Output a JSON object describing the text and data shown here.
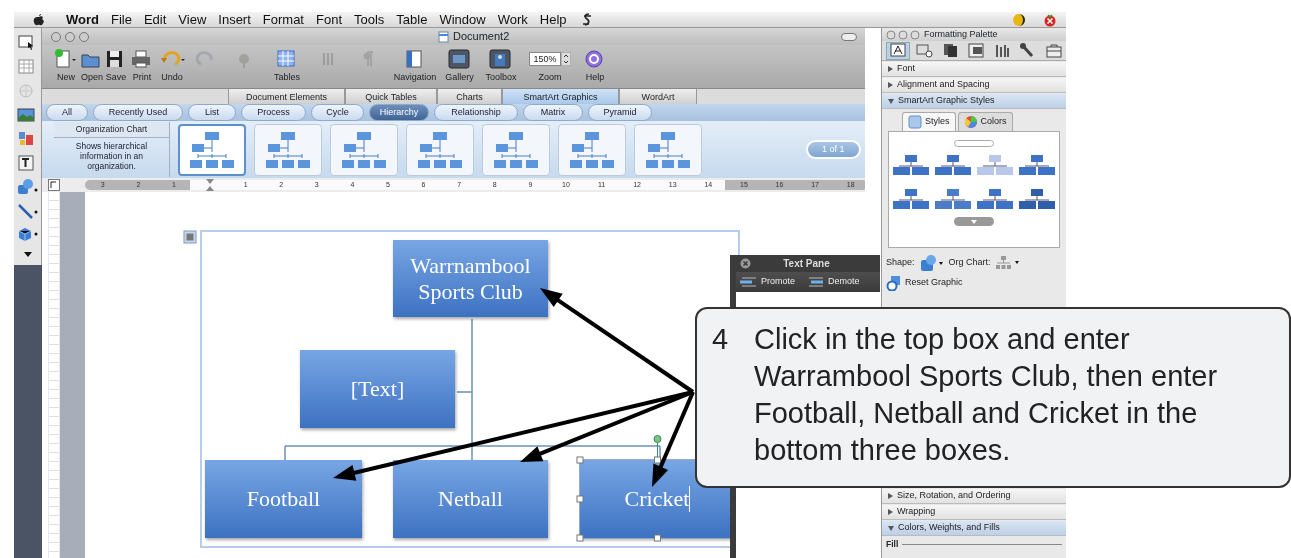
{
  "menu_bar": {
    "app": "Word",
    "items": [
      "File",
      "Edit",
      "View",
      "Insert",
      "Format",
      "Font",
      "Tools",
      "Table",
      "Window",
      "Work",
      "Help"
    ]
  },
  "window": {
    "title": "Document2"
  },
  "toolbar": [
    {
      "kind": "button",
      "label": "New",
      "disabled": false,
      "pressed": false
    },
    {
      "kind": "button",
      "label": "Open",
      "disabled": false,
      "pressed": false
    },
    {
      "kind": "button",
      "label": "Save",
      "disabled": false,
      "pressed": false
    },
    {
      "kind": "button",
      "label": "Print",
      "disabled": false,
      "pressed": false
    },
    {
      "kind": "button",
      "label": "Undo",
      "disabled": false,
      "pressed": false
    },
    {
      "kind": "button",
      "disabled": true,
      "pressed": false
    },
    {
      "kind": "button",
      "disabled": true,
      "pressed": false
    },
    {
      "kind": "button",
      "label": "Tables",
      "disabled": false,
      "pressed": false
    },
    {
      "kind": "button",
      "disabled": true,
      "pressed": false
    },
    {
      "kind": "button",
      "disabled": true,
      "pressed": false
    },
    {
      "kind": "button",
      "label": "Navigation",
      "disabled": false,
      "pressed": false
    },
    {
      "kind": "button",
      "label": "Gallery",
      "disabled": false,
      "pressed": true
    },
    {
      "kind": "button",
      "label": "Toolbox",
      "disabled": false,
      "pressed": true
    },
    {
      "kind": "zoom",
      "label": "Zoom",
      "value": "150%"
    },
    {
      "kind": "button",
      "label": "Help",
      "disabled": false,
      "pressed": false
    }
  ],
  "gallery_tabs": [
    {
      "label": "Document Elements",
      "selected": false
    },
    {
      "label": "Quick Tables",
      "selected": false
    },
    {
      "label": "Charts",
      "selected": false
    },
    {
      "label": "SmartArt Graphics",
      "selected": true
    },
    {
      "label": "WordArt",
      "selected": false
    }
  ],
  "categories": [
    {
      "label": "All",
      "selected": false
    },
    {
      "label": "Recently Used",
      "selected": false
    },
    {
      "label": "List",
      "selected": false
    },
    {
      "label": "Process",
      "selected": false
    },
    {
      "label": "Cycle",
      "selected": false
    },
    {
      "label": "Hierarchy",
      "selected": true
    },
    {
      "label": "Relationship",
      "selected": false
    },
    {
      "label": "Matrix",
      "selected": false
    },
    {
      "label": "Pyramid",
      "selected": false
    }
  ],
  "gallery": {
    "title": "Organization Chart",
    "description": "Shows hierarchical information in an organization.",
    "thumbnails": [
      {
        "selected": true
      },
      {
        "selected": false
      },
      {
        "selected": false
      },
      {
        "selected": false
      },
      {
        "selected": false
      },
      {
        "selected": false
      },
      {
        "selected": false
      }
    ],
    "pager": "1 of 1"
  },
  "ruler": [
    "3",
    "2",
    "1",
    "1",
    "2",
    "3",
    "4",
    "5",
    "6",
    "7",
    "8",
    "9",
    "10",
    "11",
    "12",
    "13",
    "14",
    "15",
    "16",
    "17",
    "18"
  ],
  "diagram": {
    "nodes": [
      {
        "text": "Warrnambool Sports Club",
        "selected": false
      },
      {
        "text": "[Text]",
        "selected": false
      },
      {
        "text": "Football",
        "selected": false
      },
      {
        "text": "Netball",
        "selected": false
      },
      {
        "text": "Cricket",
        "selected": true
      }
    ]
  },
  "text_pane": {
    "title": "Text Pane",
    "buttons": [
      "Promote",
      "Demote"
    ]
  },
  "palette": {
    "title": "Formatting Palette",
    "tool_tabs": [
      {
        "selected": true
      },
      {
        "selected": false
      },
      {
        "selected": false
      },
      {
        "selected": false
      },
      {
        "selected": false
      },
      {
        "selected": false
      },
      {
        "selected": false
      }
    ],
    "sections": [
      {
        "title": "Font",
        "expanded": false
      },
      {
        "title": "Alignment and Spacing",
        "expanded": false
      },
      {
        "kind": "styles",
        "title": "SmartArt Graphic Styles",
        "expanded": true,
        "tabs": [
          {
            "label": "Styles",
            "selected": true
          },
          {
            "label": "Colors",
            "selected": false
          }
        ],
        "shape_label": "Shape:",
        "org_chart_label": "Org Chart:",
        "reset_button": "Reset Graphic"
      },
      {
        "title": "Size, Rotation, and Ordering",
        "expanded": false
      },
      {
        "title": "Wrapping",
        "expanded": false
      },
      {
        "kind": "fills",
        "title": "Colors, Weights, and Fills",
        "expanded": true,
        "fill_label": "Fill"
      }
    ]
  },
  "callout": {
    "number": "4",
    "text": "Click in the top box and enter Warrambool Sports Club, then enter Football, Netball and Cricket in the bottom three boxes."
  }
}
